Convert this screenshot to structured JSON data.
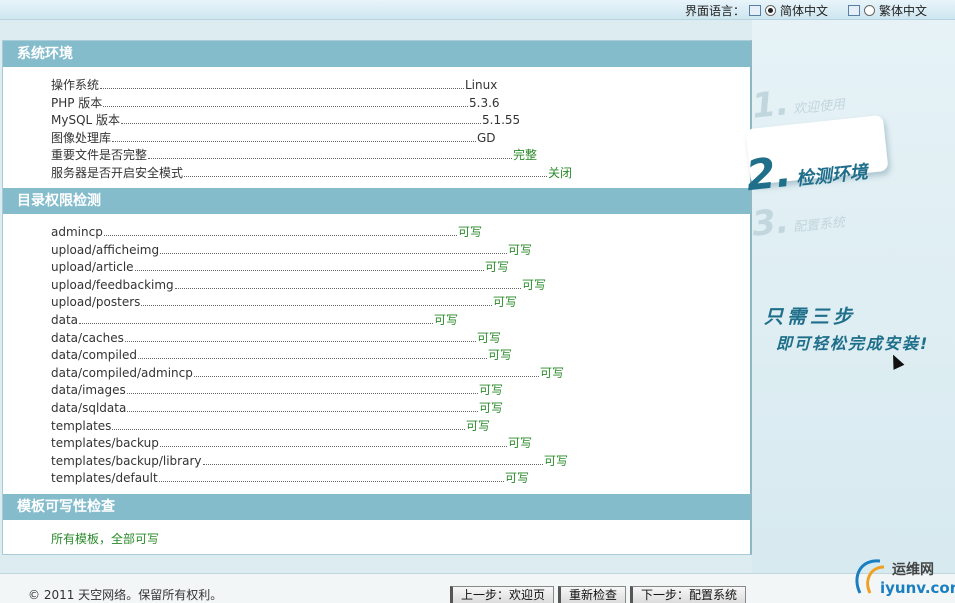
{
  "language_bar": {
    "label": "界面语言：",
    "options": [
      {
        "label": "简体中文",
        "selected": true
      },
      {
        "label": "繁体中文",
        "selected": false
      }
    ]
  },
  "system": {
    "title": "系统环境",
    "rows": [
      {
        "label": "操作系统",
        "value": "Linux",
        "ok": false
      },
      {
        "label": "PHP 版本",
        "value": "5.3.6",
        "ok": false
      },
      {
        "label": "MySQL 版本",
        "value": "5.1.55",
        "ok": false
      },
      {
        "label": "图像处理库",
        "value": "GD",
        "ok": false
      },
      {
        "label": "重要文件是否完整",
        "value": "完整",
        "ok": true
      },
      {
        "label": "服务器是否开启安全模式",
        "value": "关闭",
        "ok": true
      }
    ]
  },
  "dirs": {
    "title": "目录权限检测",
    "rows": [
      {
        "label": "admincp",
        "value": "可写"
      },
      {
        "label": "upload/afficheimg",
        "value": "可写"
      },
      {
        "label": "upload/article",
        "value": "可写"
      },
      {
        "label": "upload/feedbackimg",
        "value": "可写"
      },
      {
        "label": "upload/posters",
        "value": "可写"
      },
      {
        "label": "data",
        "value": "可写"
      },
      {
        "label": "data/caches",
        "value": "可写"
      },
      {
        "label": "data/compiled",
        "value": "可写"
      },
      {
        "label": "data/compiled/admincp",
        "value": "可写"
      },
      {
        "label": "data/images",
        "value": "可写"
      },
      {
        "label": "data/sqldata",
        "value": "可写"
      },
      {
        "label": "templates",
        "value": "可写"
      },
      {
        "label": "templates/backup",
        "value": "可写"
      },
      {
        "label": "templates/backup/library",
        "value": "可写"
      },
      {
        "label": "templates/default",
        "value": "可写"
      }
    ]
  },
  "templates_check": {
    "title": "模板可写性检查",
    "result": "所有模板，全部可写"
  },
  "steps": {
    "step1_num": "1.",
    "step1_text": "欢迎使用",
    "step2_num": "2.",
    "step2_text": "检测环境",
    "step3_num": "3.",
    "step3_text": "配置系统"
  },
  "slogan": {
    "line1": "只需三步",
    "line2": "即可轻松完成安装!"
  },
  "footer": {
    "copyright_prefix": "© 2011 ",
    "brand": "天空网络",
    "copyright_suffix": "。保留所有权利。",
    "prev_button": "上一步：欢迎页",
    "recheck_button": "重新检查",
    "next_button": "下一步：配置系统"
  },
  "watermark": {
    "cn": "运维网",
    "en": "iyunv.com"
  }
}
